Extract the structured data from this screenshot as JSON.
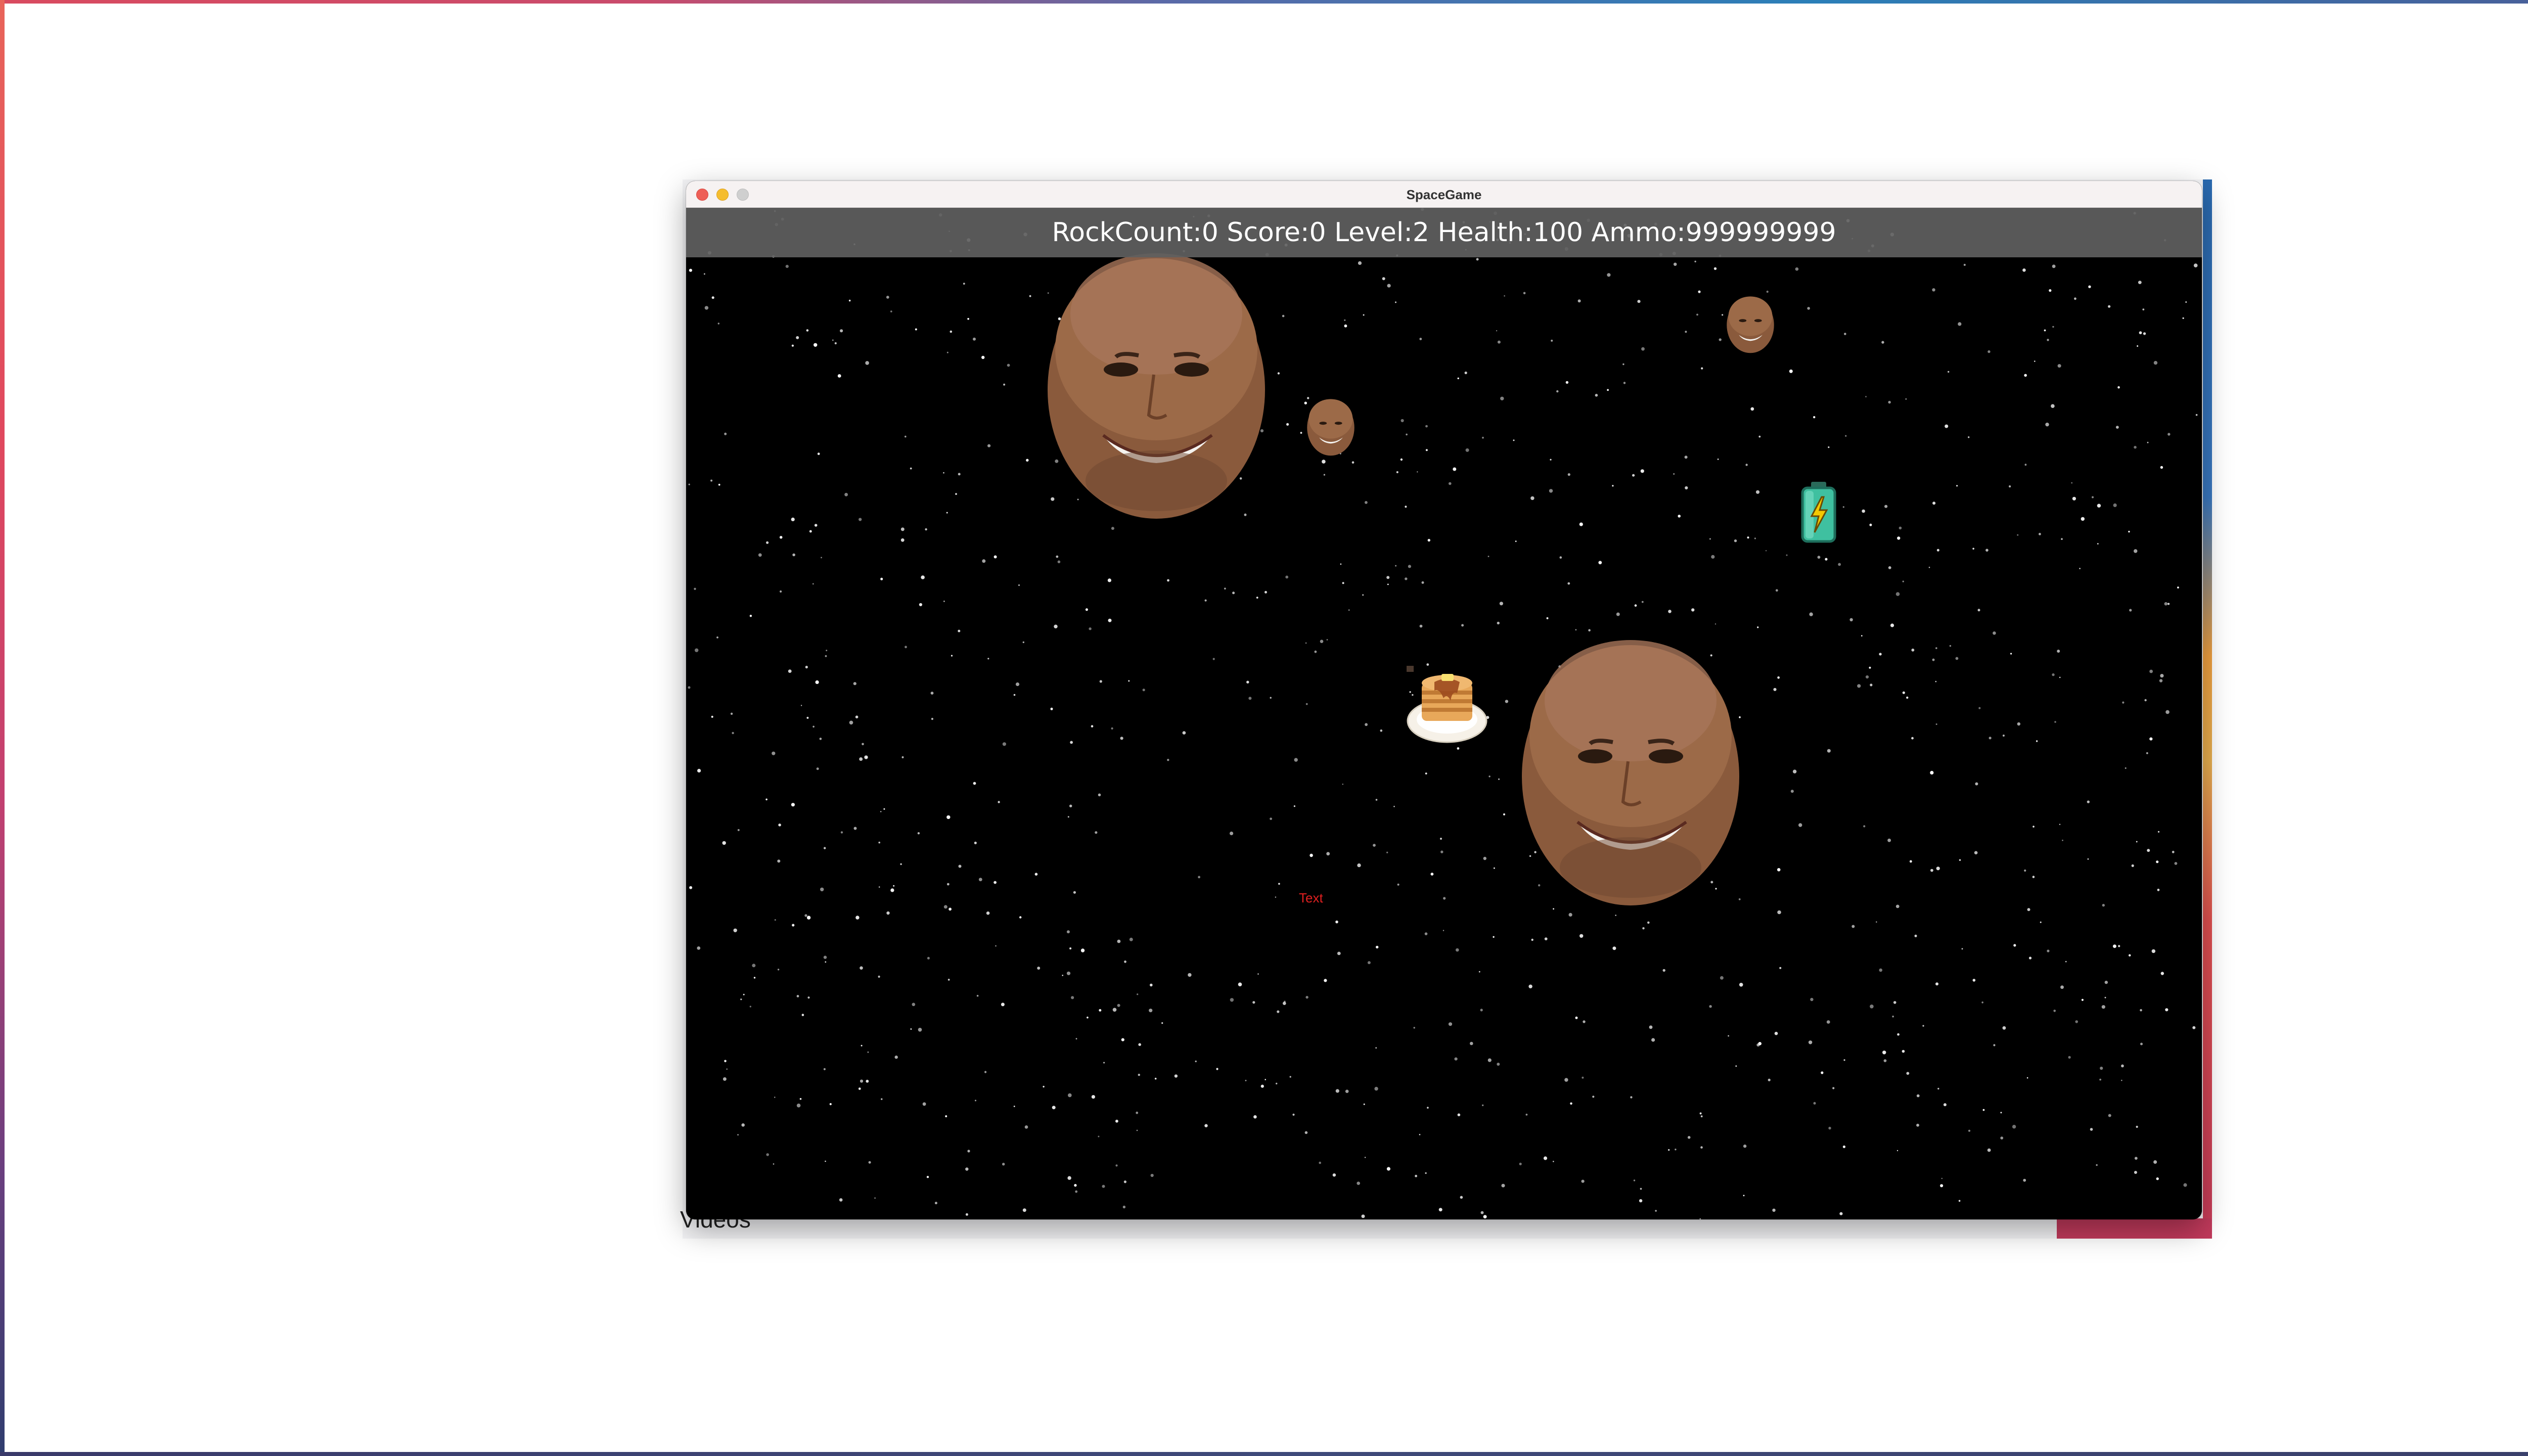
{
  "window": {
    "title": "SpaceGame"
  },
  "hud": {
    "text": "RockCount:0 Score:0 Level:2 Health:100 Ammo:999999999"
  },
  "game": {
    "floating_label": "Text",
    "sprites": [
      {
        "name": "rock-head-large-1",
        "icon": "rock-head"
      },
      {
        "name": "rock-head-small-1",
        "icon": "rock-head"
      },
      {
        "name": "rock-head-small-2",
        "icon": "rock-head"
      },
      {
        "name": "rock-head-large-2",
        "icon": "rock-head"
      },
      {
        "name": "battery-powerup",
        "icon": "battery-icon"
      },
      {
        "name": "pancake-powerup",
        "icon": "pancake-icon"
      }
    ]
  },
  "background_app": {
    "partial_text": "Videos"
  },
  "colors": {
    "hud_bg": "#5f5f5f",
    "space_bg": "#000000",
    "label_red": "#e02020",
    "battery_green": "#3fc0a0",
    "bolt_yellow": "#f5c800"
  }
}
